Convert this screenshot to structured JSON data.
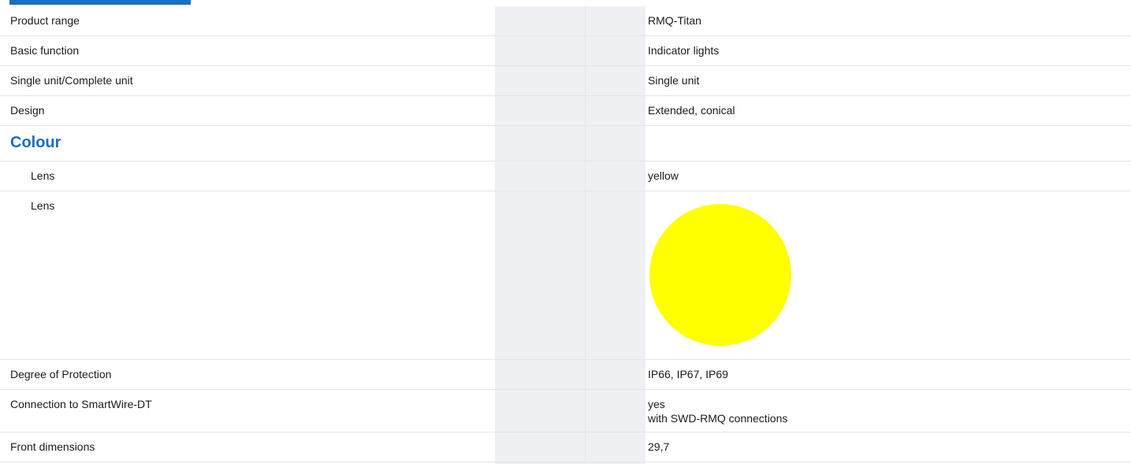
{
  "rows": [
    {
      "label": "Product range",
      "value": "RMQ-Titan"
    },
    {
      "label": "Basic function",
      "value": "Indicator lights"
    },
    {
      "label": "Single unit/Complete unit",
      "value": "Single unit"
    },
    {
      "label": "Design",
      "value": "Extended, conical"
    }
  ],
  "section": {
    "title": "Colour"
  },
  "colour_rows": {
    "lens_text": {
      "label": "Lens",
      "value": "yellow"
    },
    "lens_swatch": {
      "label": "Lens",
      "swatch_color": "#ffff00"
    }
  },
  "rows_after": {
    "protection": {
      "label": "Degree of Protection",
      "value": "IP66, IP67, IP69"
    },
    "smartwire": {
      "label": "Connection to SmartWire-DT",
      "value_line1": "yes",
      "value_line2": "with SWD-RMQ connections"
    },
    "front_dimensions": {
      "label": "Front dimensions",
      "value": "29,7"
    }
  },
  "colors": {
    "accent": "#1a6fc0",
    "column_shade": "#eef0f4",
    "row_border": "#e3e5e8"
  }
}
